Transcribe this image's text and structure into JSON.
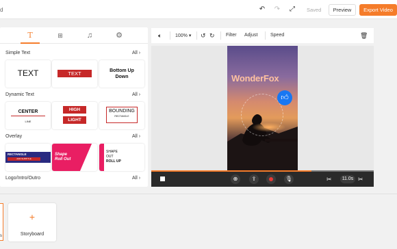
{
  "topbar": {
    "left_fragment": "d",
    "undo_icon": "undo-icon",
    "redo_icon": "redo-icon",
    "fullscreen_icon": "fullscreen-icon",
    "saved_label": "Saved",
    "preview_label": "Preview",
    "export_label": "Export Video",
    "accent": "#f57c2a"
  },
  "left_panel": {
    "tabs": [
      {
        "icon": "text-icon",
        "active": true
      },
      {
        "icon": "elements-icon",
        "active": false
      },
      {
        "icon": "music-icon",
        "active": false
      },
      {
        "icon": "settings-icon",
        "active": false
      }
    ],
    "sections": {
      "simple": {
        "title": "Simple Text",
        "all": "All"
      },
      "dynamic": {
        "title": "Dynamic Text",
        "all": "All"
      },
      "overlay": {
        "title": "Overlay",
        "all": "All"
      },
      "logo": {
        "title": "Logo/Intro/Outro",
        "all": "All"
      }
    },
    "simple_cards": {
      "c1": "TEXT",
      "c2": "TEXT",
      "c3a": "Bottom Up",
      "c3b": "Down"
    },
    "dynamic_cards": {
      "c1a": "CENTER",
      "c1b": "LINE",
      "c2a": "HIGH",
      "c2b": "LIGHT",
      "c3a": "BOUNDING",
      "c3b": "RECTANGLE"
    },
    "overlay_cards": {
      "c1a": "RECTANGLE",
      "c1b": "ADD SUBTITLE",
      "c2a": "Shape",
      "c2b": "Roll Out",
      "c3a": "SHAPE",
      "c3b": "OUT",
      "c3c": "ROLL UP"
    }
  },
  "editor": {
    "volume_icon": "volume-icon",
    "zoom": "100%",
    "rotate_left_icon": "rotate-left-icon",
    "rotate_right_icon": "rotate-right-icon",
    "filter_label": "Filter",
    "adjust_label": "Adjust",
    "speed_label": "Speed",
    "delete_icon": "trash-icon",
    "video_title": "WonderFox",
    "like_icon": "thumbs-up-icon",
    "progress": 0.72,
    "duration": "11.0s"
  },
  "bottom": {
    "storyboard_label": "Storyboard",
    "add_icon": "plus-icon"
  }
}
